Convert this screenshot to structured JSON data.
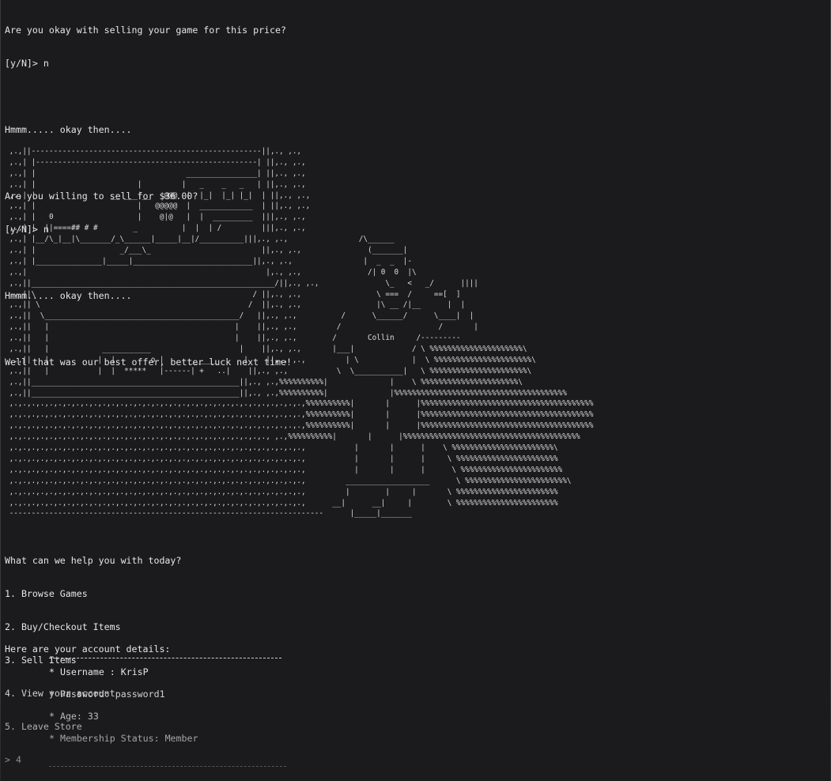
{
  "terminal": {
    "prior_dialogue": [
      "Are you okay with selling your game for this price?",
      "[y/N]> n",
      "",
      "Hmmm..... okay then....",
      "",
      "Are you willing to sell for $36.00?",
      "[y/N]> n",
      "",
      "Hmmm..... okay then....",
      "",
      "Well that was our best offer, better luck next time!"
    ],
    "ascii_art": [
      " ,.,||----------------------------------------------------||,., ,.,",
      " ,.,| |--------------------------------------------------| ||,., ,.,",
      " ,.,| |                                  ________________| ||,., ,.,",
      " ,.,| |                       |         |   _    _   _   | ||,., ,.,",
      " ,.,| |                 __ ___|__   @@@  |  |_|  |_| |_|  | ||,., ,.,",
      " ,.,| |                       |   @@@@@  |  ____________  | ||,., ,.,",
      " ,.,| |   0                   |    @|@   |  |  _________  |||,., ,.,",
      " ,.,| |  ||====## # #        _          |  |  | /         |||,., ,.,",
      " ,.,| |__/\\_|__|\\_______/_\\______|_____|__|/__________|||,., ,.,                /\\______",
      " ,.,| |                   _/___\\_                         ||,., ,.,               (_______|",
      " ,.,| |_______________|_____|___________________________||,., ,.,                |  _  _  |-",
      " ,.,|                                                      |,., ,.,               /| 0  0  |\\",
      " ,.,||_______________________________________________________/||,., ,.,               \\_   <   _/      ||||",
      " ,.,||\\                                                 / ||,., ,.,                 \\ ===  /     ==[  ]",
      " ,.,|| \\                                               /  ||,., ,.,                 |\\ __ /|__      |  |",
      " ,.,||  \\____________________________________________/   ||,., ,.,          /      \\______/      \\____|  |",
      " ,.,||   |                                          |    ||,., ,.,         /                      /       |",
      " ,.,||   |                                          |    ||,., ,.,        /       Collin     /---------",
      " ,.,||   |            ___________                    |    ||,., ,.,       |___|             / \\ %%%%%%%%%%%%%%%%%%%%%\\",
      " ,.,||   |           |  |        o |      ______      |    ||,., ,.,         | \\            |  \\ %%%%%%%%%%%%%%%%%%%%%%\\",
      " ,.,||   |           |  |  *****   |------| +   ..|    ||,., ,.,           \\  \\___________|   \\ %%%%%%%%%%%%%%%%%%%%%%\\",
      " ,.,||_______________________________________________||,., ,.,%%%%%%%%%%|              |    \\ %%%%%%%%%%%%%%%%%%%%%%\\",
      " ,.,||_______________________________________________||,., ,.,%%%%%%%%%%|              |%%%%%%%%%%%%%%%%%%%%%%%%%%%%%%%%%%%%%%%",
      " ,.,.,.,.,.,.,.,.,.,.,.,.,.,.,.,.,.,.,.,.,.,.,.,.,.,.,.,.,.,.,.,.,.,%%%%%%%%%%|       |      |%%%%%%%%%%%%%%%%%%%%%%%%%%%%%%%%%%%%%%%",
      " ,.,.,.,.,.,.,.,.,.,.,.,.,.,.,.,.,.,.,.,.,.,.,.,.,.,.,.,.,.,.,.,.,.,%%%%%%%%%%|       |      |%%%%%%%%%%%%%%%%%%%%%%%%%%%%%%%%%%%%%%%",
      " ,.,.,.,.,.,.,.,.,.,.,.,.,.,.,.,.,.,.,.,.,.,.,.,.,.,.,.,.,.,.,.,.,.,%%%%%%%%%%|       |      |%%%%%%%%%%%%%%%%%%%%%%%%%%%%%%%%%%%%%%%",
      " ,.,.,.,.,.,.,.,.,.,.,.,.,.,.,.,.,.,.,.,.,.,.,.,.,.,.,.,.,., ,.,%%%%%%%%%%|       |      |%%%%%%%%%%%%%%%%%%%%%%%%%%%%%%%%%%%%%%%%",
      " ,.,.,.,.,.,.,.,.,.,.,.,.,.,.,.,.,.,.,.,.,.,.,.,.,.,.,.,.,.,.,.,.,.,           |       |      |    \\ %%%%%%%%%%%%%%%%%%%%%%%\\",
      " ,.,.,.,.,.,.,.,.,.,.,.,.,.,.,.,.,.,.,.,.,.,.,.,.,.,.,.,.,.,.,.,.,.,           |       |      |     \\ %%%%%%%%%%%%%%%%%%%%%%%",
      " ,.,.,.,.,.,.,.,.,.,.,.,.,.,.,.,.,.,.,.,.,.,.,.,.,.,.,.,.,.,.,.,.,.,           |       |      |      \\ %%%%%%%%%%%%%%%%%%%%%%%",
      " ,.,.,.,.,.,.,.,.,.,.,.,.,.,.,.,.,.,.,.,.,.,.,.,.,.,.,.,.,.,.,.,.,.,         ___________________      \\ %%%%%%%%%%%%%%%%%%%%%%%\\",
      " ,.,.,.,.,.,.,.,.,.,.,.,.,.,.,.,.,.,.,.,.,.,.,.,.,.,.,.,.,.,.,.,.,.,         |        |     |       \\ %%%%%%%%%%%%%%%%%%%%%%%",
      " ,.,.,.,.,.,.,.,.,.,.,.,.,.,.,.,.,.,.,.,.,.,.,.,.,.,.,.,.,.,.,.,.,.,      __|      __|     |        \\ %%%%%%%%%%%%%%%%%%%%%%%",
      " -----------------------------------------------------------------------      |_____|_______"
    ],
    "menu": [
      "What can we help you with today?",
      "1. Browse Games",
      "2. Buy/Checkout Items",
      "3. Sell Items",
      "4. View your account",
      "5. Leave Store",
      "> 4"
    ],
    "account_heading": "Here are your account details:",
    "account": {
      "username": "* Username : KrisP",
      "password": "* Password: password1",
      "age": "* Age: 33",
      "membership": "* Membership Status: Member"
    }
  }
}
